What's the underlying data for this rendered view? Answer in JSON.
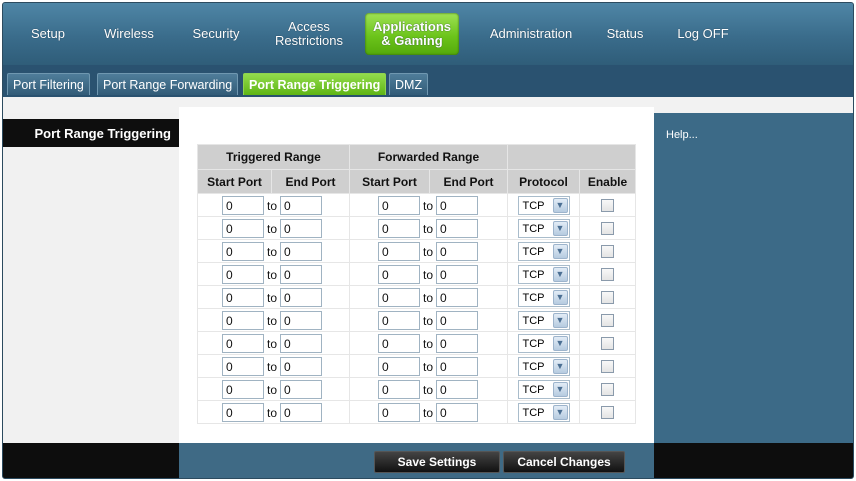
{
  "topnav": {
    "items": [
      {
        "label": "Setup"
      },
      {
        "label": "Wireless"
      },
      {
        "label": "Security"
      },
      {
        "label": "Access\nRestrictions"
      },
      {
        "label": "Applications\n& Gaming"
      },
      {
        "label": "Administration"
      },
      {
        "label": "Status"
      },
      {
        "label": "Log OFF"
      }
    ],
    "active_index": 4
  },
  "subtabs": {
    "items": [
      {
        "label": "Port Filtering"
      },
      {
        "label": "Port Range Forwarding"
      },
      {
        "label": "Port Range Triggering"
      },
      {
        "label": "DMZ"
      }
    ],
    "active_index": 2
  },
  "sidebar": {
    "title": "Port Range Triggering"
  },
  "help": {
    "label": "Help..."
  },
  "table": {
    "group_headers": {
      "triggered": "Triggered Range",
      "forwarded": "Forwarded Range"
    },
    "column_headers": {
      "start": "Start Port",
      "end": "End Port",
      "protocol": "Protocol",
      "enable": "Enable"
    },
    "to_label": "to",
    "rows": [
      {
        "t_start": "0",
        "t_end": "0",
        "f_start": "0",
        "f_end": "0",
        "protocol": "TCP",
        "enabled": false
      },
      {
        "t_start": "0",
        "t_end": "0",
        "f_start": "0",
        "f_end": "0",
        "protocol": "TCP",
        "enabled": false
      },
      {
        "t_start": "0",
        "t_end": "0",
        "f_start": "0",
        "f_end": "0",
        "protocol": "TCP",
        "enabled": false
      },
      {
        "t_start": "0",
        "t_end": "0",
        "f_start": "0",
        "f_end": "0",
        "protocol": "TCP",
        "enabled": false
      },
      {
        "t_start": "0",
        "t_end": "0",
        "f_start": "0",
        "f_end": "0",
        "protocol": "TCP",
        "enabled": false
      },
      {
        "t_start": "0",
        "t_end": "0",
        "f_start": "0",
        "f_end": "0",
        "protocol": "TCP",
        "enabled": false
      },
      {
        "t_start": "0",
        "t_end": "0",
        "f_start": "0",
        "f_end": "0",
        "protocol": "TCP",
        "enabled": false
      },
      {
        "t_start": "0",
        "t_end": "0",
        "f_start": "0",
        "f_end": "0",
        "protocol": "TCP",
        "enabled": false
      },
      {
        "t_start": "0",
        "t_end": "0",
        "f_start": "0",
        "f_end": "0",
        "protocol": "TCP",
        "enabled": false
      },
      {
        "t_start": "0",
        "t_end": "0",
        "f_start": "0",
        "f_end": "0",
        "protocol": "TCP",
        "enabled": false
      }
    ]
  },
  "buttons": {
    "save": "Save Settings",
    "cancel": "Cancel Changes"
  },
  "colors": {
    "accent_green": "#6cc41b",
    "nav_blue": "#3a6c8b",
    "panel_blue": "#3c6a87"
  },
  "icons": {
    "dropdown": "chevron-down-icon",
    "checkbox": "checkbox-icon"
  }
}
